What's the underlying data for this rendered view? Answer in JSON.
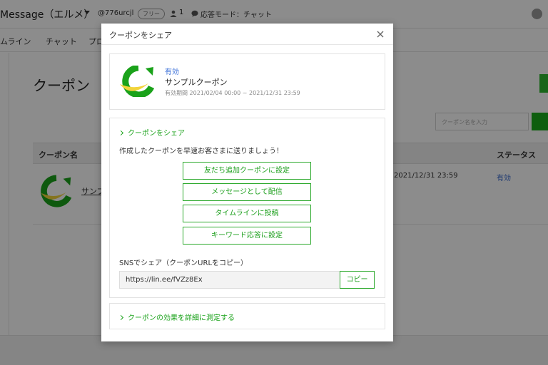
{
  "header": {
    "app_name": "Message（エルメ）",
    "account_id": "@776urcjl",
    "plan": "フリー",
    "user_count": "1",
    "mode": "応答モード：チャット"
  },
  "nav": {
    "items": [
      "ムライン",
      "チャット",
      "プロ"
    ]
  },
  "page": {
    "title": "クーポン",
    "search_placeholder": "クーポン名を入力"
  },
  "table": {
    "headers": {
      "name": "クーポン名",
      "status": "ステータス"
    },
    "rows": [
      {
        "name": "サンプ",
        "date": "2021/12/31 23:59",
        "status": "有効"
      }
    ]
  },
  "modal": {
    "title": "クーポンをシェア",
    "coupon": {
      "status": "有効",
      "name": "サンプルクーポン",
      "period": "有効期間 2021/02/04 00:00 ~ 2021/12/31 23:59"
    },
    "share_section": {
      "toggle_label": "クーポンをシェア",
      "intro": "作成したクーポンを早速お客さまに送りましょう！",
      "buttons": [
        "友だち追加クーポンに設定",
        "メッセージとして配信",
        "タイムラインに投稿",
        "キーワード応答に設定"
      ],
      "sns_label": "SNSでシェア（クーポンURLをコピー）",
      "url": "https://lin.ee/fVZz8Ex",
      "copy_label": "コピー"
    },
    "measure_label": "クーポンの効果を詳細に測定する"
  },
  "colors": {
    "accent_green": "#1aa21a",
    "link_blue": "#3a6fd8",
    "logo_yellow": "#f2d43b"
  }
}
